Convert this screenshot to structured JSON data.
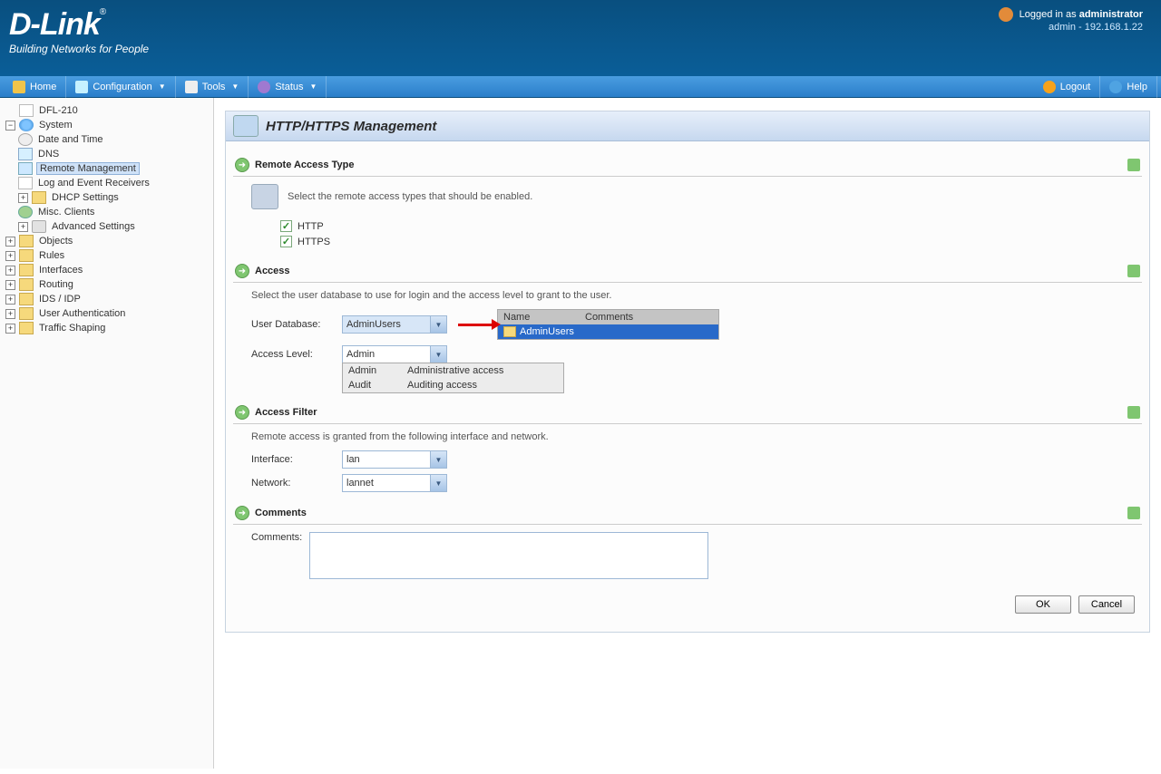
{
  "header": {
    "brand": "D-Link",
    "tagline": "Building Networks for People",
    "login_prefix": "Logged in as ",
    "login_user": "administrator",
    "login_sub": "admin - 192.168.1.22"
  },
  "menubar": {
    "home": "Home",
    "config": "Configuration",
    "tools": "Tools",
    "status": "Status",
    "logout": "Logout",
    "help": "Help"
  },
  "tree": {
    "root": "DFL-210",
    "system": "System",
    "date_time": "Date and Time",
    "dns": "DNS",
    "remote_mgmt": "Remote Management",
    "log_evt": "Log and Event Receivers",
    "dhcp": "DHCP Settings",
    "misc": "Misc. Clients",
    "advanced": "Advanced Settings",
    "objects": "Objects",
    "rules": "Rules",
    "interfaces": "Interfaces",
    "routing": "Routing",
    "ids": "IDS / IDP",
    "user_auth": "User Authentication",
    "traffic": "Traffic Shaping"
  },
  "page": {
    "title": "HTTP/HTTPS Management",
    "sections": {
      "remote_access": {
        "title": "Remote Access Type",
        "desc": "Select the remote access types that should be enabled.",
        "opt_http": "HTTP",
        "opt_https": "HTTPS"
      },
      "access": {
        "title": "Access",
        "desc": "Select the user database to use for login and the access level to grant to the user.",
        "lbl_userdb": "User Database:",
        "val_userdb": "AdminUsers",
        "lbl_level": "Access Level:",
        "val_level": "Admin",
        "options": [
          {
            "name": "Admin",
            "desc": "Administrative access"
          },
          {
            "name": "Audit",
            "desc": "Auditing access"
          }
        ],
        "dd_col_name": "Name",
        "dd_col_comments": "Comments",
        "dd_item": "AdminUsers"
      },
      "filter": {
        "title": "Access Filter",
        "desc": "Remote access is granted from the following interface and network.",
        "lbl_interface": "Interface:",
        "val_interface": "lan",
        "lbl_network": "Network:",
        "val_network": "lannet"
      },
      "comments": {
        "title": "Comments",
        "lbl": "Comments:"
      }
    },
    "buttons": {
      "ok": "OK",
      "cancel": "Cancel"
    }
  }
}
